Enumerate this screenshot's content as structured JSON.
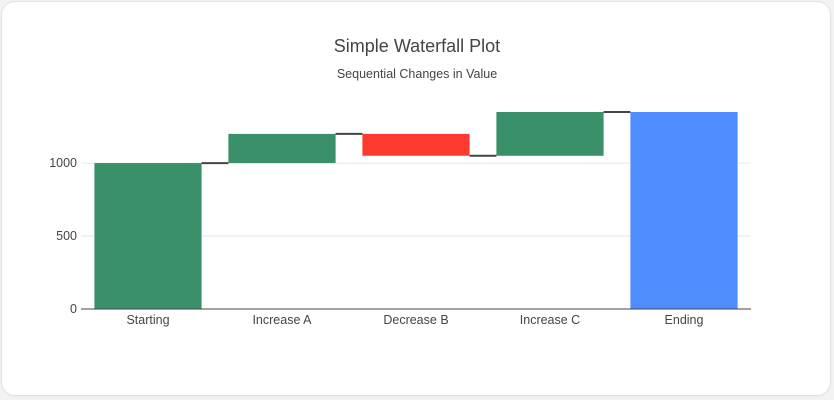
{
  "chart_data": {
    "type": "waterfall",
    "title": "Simple Waterfall Plot",
    "subtitle": "Sequential Changes in Value",
    "categories": [
      "Starting",
      "Increase A",
      "Decrease B",
      "Increase C",
      "Ending"
    ],
    "measures": [
      "absolute",
      "relative",
      "relative",
      "relative",
      "total"
    ],
    "values": [
      1000,
      200,
      -150,
      300,
      1350
    ],
    "ylim": [
      0,
      1350
    ],
    "yticks": [
      0,
      500,
      1000
    ],
    "grid": true,
    "colors": {
      "increase": "#3a9068",
      "decrease": "#fd3a2f",
      "total": "#4f8cff",
      "connector": "#444444",
      "grid": "#e6e6e6",
      "axis": "#444444"
    }
  }
}
